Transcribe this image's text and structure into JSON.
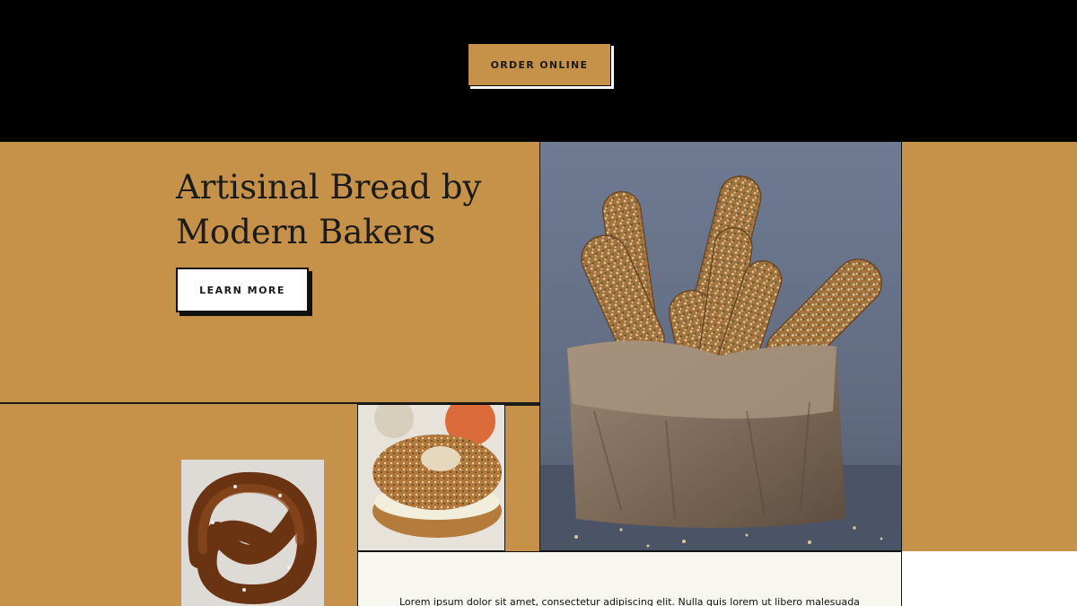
{
  "header": {
    "order_label": "ORDER ONLINE"
  },
  "hero": {
    "title": "Artisinal Bread by Modern Bakers",
    "learn_label": "LEARN MORE"
  },
  "content": {
    "body_text": "Lorem ipsum dolor sit amet, consectetur adipiscing elit. Nulla quis lorem ut libero malesuada"
  },
  "colors": {
    "accent": "#c69249",
    "header_bg": "#000000",
    "text_panel_bg": "#f7f7ef"
  }
}
